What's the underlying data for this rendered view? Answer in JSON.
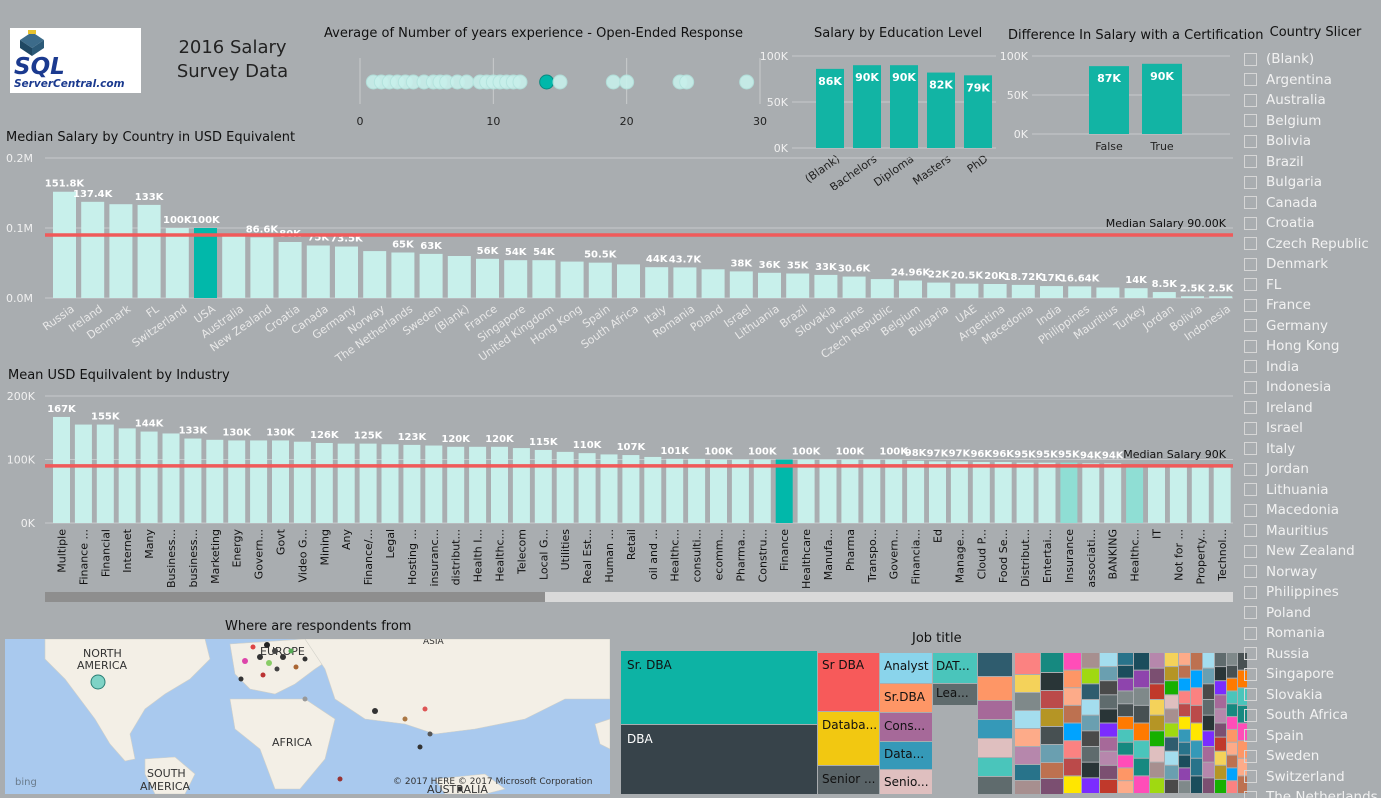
{
  "logo": {
    "line1": "SQL",
    "line2": "ServerCentral.com"
  },
  "report_title": "2016 Salary Survey Data",
  "colors": {
    "bar": "#c8f0eb",
    "bar_highlight": "#01b8aa",
    "median_line": "#f05a5a",
    "edu_bar": "#12b4a4"
  },
  "experience_chart": {
    "title": "Average of Number of years experience - Open-Ended Response",
    "chart_data": {
      "type": "scatter",
      "xlim": [
        0,
        30
      ],
      "x_ticks": [
        0,
        10,
        20,
        30
      ],
      "x": [
        1,
        1.6,
        2.2,
        2.8,
        3.4,
        4,
        4.8,
        5.5,
        6,
        6.5,
        7.3,
        8,
        9,
        9.5,
        10,
        10.5,
        11,
        11.5,
        12,
        14,
        15,
        19,
        20,
        24,
        24.5,
        29
      ],
      "highlight_x": 14
    }
  },
  "education_chart": {
    "title": "Salary by Education Level",
    "chart_data": {
      "type": "bar",
      "categories": [
        "(Blank)",
        "Bachelors",
        "Diploma",
        "Masters",
        "PhD"
      ],
      "values": [
        86,
        90,
        90,
        82,
        79
      ],
      "data_labels": [
        "86K",
        "90K",
        "90K",
        "82K",
        "79K"
      ],
      "y_ticks": [
        "100K",
        "50K",
        "0K"
      ],
      "ylim": [
        0,
        100
      ]
    }
  },
  "cert_chart": {
    "title": "Difference In Salary with a Certification",
    "chart_data": {
      "type": "bar",
      "categories": [
        "False",
        "True"
      ],
      "values": [
        87,
        90
      ],
      "data_labels": [
        "87K",
        "90K"
      ],
      "y_ticks": [
        "100K",
        "50K",
        "0K"
      ],
      "ylim": [
        0,
        100
      ]
    }
  },
  "country_chart": {
    "title": "Median Salary by Country in USD Equivalent",
    "median_label": "Median Salary 90.00K",
    "chart_data": {
      "type": "bar",
      "y_ticks": [
        "0.2M",
        "0.1M",
        "0.0M"
      ],
      "ylim": [
        0,
        200000
      ],
      "median": 90000,
      "highlight": "USA",
      "categories": [
        "Russia",
        "Ireland",
        "Denmark",
        "FL",
        "Switzerland",
        "USA",
        "Australia",
        "New Zealand",
        "Croatia",
        "Canada",
        "Germany",
        "Norway",
        "The Netherlands",
        "Sweden",
        "(Blank)",
        "France",
        "Singapore",
        "United Kingdom",
        "Hong Kong",
        "Spain",
        "South Africa",
        "Italy",
        "Romania",
        "Poland",
        "Israel",
        "Lithuania",
        "Brazil",
        "Slovakia",
        "Ukraine",
        "Czech Republic",
        "Belgium",
        "Bulgaria",
        "UAE",
        "Argentina",
        "Macedonia",
        "India",
        "Philippines",
        "Mauritius",
        "Turkey",
        "Jordan",
        "Bolivia",
        "Indonesia"
      ],
      "values": [
        151800,
        137400,
        134000,
        133000,
        100000,
        100000,
        88000,
        86600,
        80000,
        75000,
        73500,
        67000,
        65000,
        63000,
        60000,
        56000,
        54000,
        54000,
        52000,
        50500,
        48000,
        44000,
        43700,
        41000,
        38000,
        36000,
        35000,
        33000,
        30600,
        27000,
        24960,
        22000,
        20500,
        20000,
        18720,
        17000,
        16640,
        15000,
        14000,
        8500,
        2500,
        2500
      ],
      "data_labels": [
        "151.8K",
        "137.4K",
        "",
        "133K",
        "100K",
        "100K",
        "",
        "86.6K",
        "80K",
        "75K",
        "73.5K",
        "",
        "65K",
        "63K",
        "",
        "56K",
        "54K",
        "54K",
        "",
        "50.5K",
        "",
        "44K",
        "43.7K",
        "",
        "38K",
        "36K",
        "35K",
        "33K",
        "30.6K",
        "",
        "24.96K",
        "22K",
        "20.5K",
        "20K",
        "18.72K",
        "17K",
        "16.64K",
        "",
        "14K",
        "8.5K",
        "2.5K",
        "2.5K"
      ]
    }
  },
  "industry_chart": {
    "title": "Mean USD Equilvalent by Industry",
    "median_label": "Median Salary 90K",
    "chart_data": {
      "type": "bar",
      "y_ticks": [
        "200K",
        "100K",
        "0K"
      ],
      "ylim": [
        0,
        200000
      ],
      "median": 90000,
      "highlight": [
        "Finance"
      ],
      "mid_highlight": [
        "Insurance",
        "Healthc..."
      ],
      "categories": [
        "Multiple",
        "Finance ...",
        "Financial",
        "Internet",
        "Many",
        "Business...",
        "business...",
        "Marketing",
        "Energy",
        "Govern...",
        "Govt",
        "Video G...",
        "Mining",
        "Any",
        "Finance/...",
        "Legal",
        "Hosting ...",
        "insuranc...",
        "distribut...",
        "Health I...",
        "Healthc...",
        "Telecom",
        "Local G...",
        "Utilities",
        "Real Est...",
        "Human ...",
        "Retail",
        "oil and ...",
        "Healthc...",
        "consulti...",
        "ecomm...",
        "Pharma...",
        "Constru...",
        "Finance",
        "Healthcare",
        "Manufa...",
        "Pharma",
        "Transpo...",
        "Govern...",
        "Financia...",
        "Ed",
        "Manage...",
        "Cloud P...",
        "Food Se...",
        "Distribut...",
        "Entertai...",
        "Insurance",
        "associati...",
        "BANKING",
        "Healthc...",
        "IT",
        "Not for ...",
        "Property...",
        "Technol..."
      ],
      "values": [
        167000,
        155000,
        155000,
        149000,
        144000,
        141000,
        133000,
        131000,
        130000,
        130000,
        130000,
        128000,
        126000,
        125000,
        125000,
        124000,
        123000,
        122000,
        120000,
        120000,
        120000,
        118000,
        115000,
        112000,
        110000,
        108000,
        107000,
        104000,
        101000,
        101000,
        100000,
        100000,
        100000,
        100000,
        100000,
        100000,
        100000,
        100000,
        100000,
        98000,
        97000,
        97000,
        96000,
        96000,
        95000,
        95000,
        95000,
        94000,
        94000,
        92000,
        92000,
        91000,
        90000,
        90000
      ],
      "data_labels": [
        "167K",
        "",
        "155K",
        "",
        "144K",
        "",
        "133K",
        "",
        "130K",
        "",
        "130K",
        "",
        "126K",
        "",
        "125K",
        "",
        "123K",
        "",
        "120K",
        "",
        "120K",
        "",
        "115K",
        "",
        "110K",
        "",
        "107K",
        "",
        "101K",
        "",
        "100K",
        "",
        "100K",
        "",
        "100K",
        "",
        "100K",
        "",
        "100K",
        "98K",
        "97K",
        "97K",
        "96K",
        "96K",
        "95K",
        "95K",
        "95K",
        "94K",
        "94K",
        "",
        "",
        "",
        "",
        ""
      ]
    }
  },
  "map": {
    "title": "Where are respondents from",
    "labels": {
      "north_america": "NORTH AMERICA",
      "europe": "EUROPE",
      "africa": "AFRICA",
      "south_america": "SOUTH AMERICA",
      "australia": "AUSTRALIA",
      "asia": "ASIA"
    },
    "copyright": "© 2017 HERE   © 2017 Microsoft Corporation",
    "brand": "bing"
  },
  "job_title": {
    "title": "Job title",
    "tiles": [
      "Sr. DBA",
      "DBA",
      "Sr DBA",
      "Databa...",
      "Senior ...",
      "Analyst",
      "Sr.DBA",
      "Cons...",
      "Data...",
      "Senio...",
      "DAT...",
      "Lea..."
    ]
  },
  "country_slicer": {
    "title": "Country Slicer",
    "items": [
      "(Blank)",
      "Argentina",
      "Australia",
      "Belgium",
      "Bolivia",
      "Brazil",
      "Bulgaria",
      "Canada",
      "Croatia",
      "Czech Republic",
      "Denmark",
      "FL",
      "France",
      "Germany",
      "Hong Kong",
      "India",
      "Indonesia",
      "Ireland",
      "Israel",
      "Italy",
      "Jordan",
      "Lithuania",
      "Macedonia",
      "Mauritius",
      "New Zealand",
      "Norway",
      "Philippines",
      "Poland",
      "Romania",
      "Russia",
      "Singapore",
      "Slovakia",
      "South Africa",
      "Spain",
      "Sweden",
      "Switzerland",
      "The Netherlands"
    ]
  }
}
